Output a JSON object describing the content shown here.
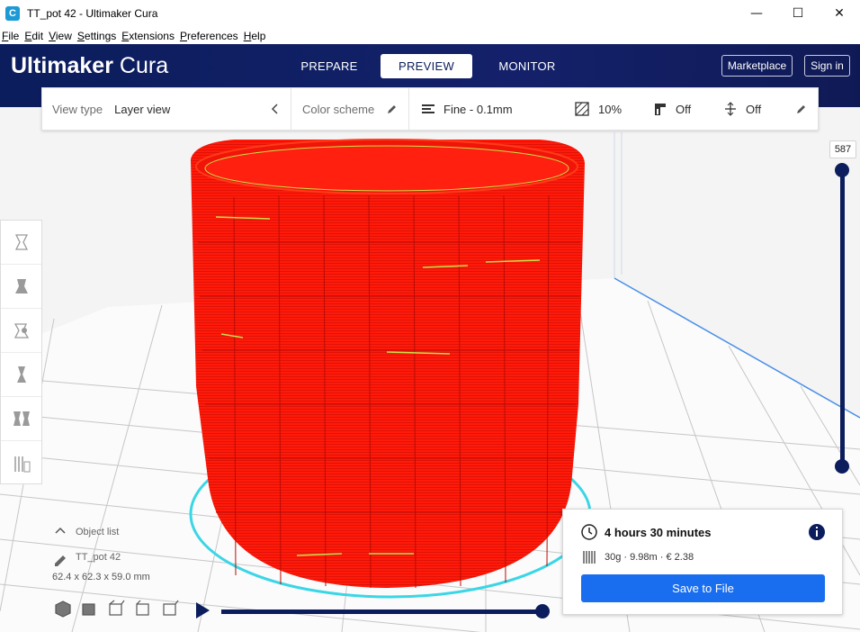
{
  "window": {
    "title": "TT_pot 42  - Ultimaker Cura",
    "app_icon_letter": "C",
    "minimize": "—",
    "maximize": "☐",
    "close": "✕"
  },
  "menu": [
    "File",
    "Edit",
    "View",
    "Settings",
    "Extensions",
    "Preferences",
    "Help"
  ],
  "header": {
    "brand_bold": "Ultimaker",
    "brand_light": "Cura",
    "tabs": [
      {
        "label": "PREPARE",
        "active": false
      },
      {
        "label": "PREVIEW",
        "active": true
      },
      {
        "label": "MONITOR",
        "active": false
      }
    ],
    "marketplace_label": "Marketplace",
    "signin_label": "Sign in"
  },
  "view_bar": {
    "view_type_label": "View type",
    "view_type_value": "Layer view",
    "color_scheme_label": "Color scheme",
    "profile_label": "Fine - 0.1mm",
    "infill_value": "10%",
    "support_value": "Off",
    "adhesion_value": "Off"
  },
  "layer_slider": {
    "current_layer": "587"
  },
  "object_list": {
    "header_label": "Object list",
    "object_name": "TT_pot 42",
    "dimensions": "62.4 x 62.3 x 59.0 mm"
  },
  "print_info": {
    "time": "4 hours 30 minutes",
    "material": "30g · 9.98m · € 2.38",
    "save_label": "Save to File"
  },
  "colors": {
    "header_bg": "#0b1d5c",
    "accent_blue": "#196ef0",
    "model_red": "#ff1a0a",
    "build_plate_outline": "#3ad6e6"
  }
}
